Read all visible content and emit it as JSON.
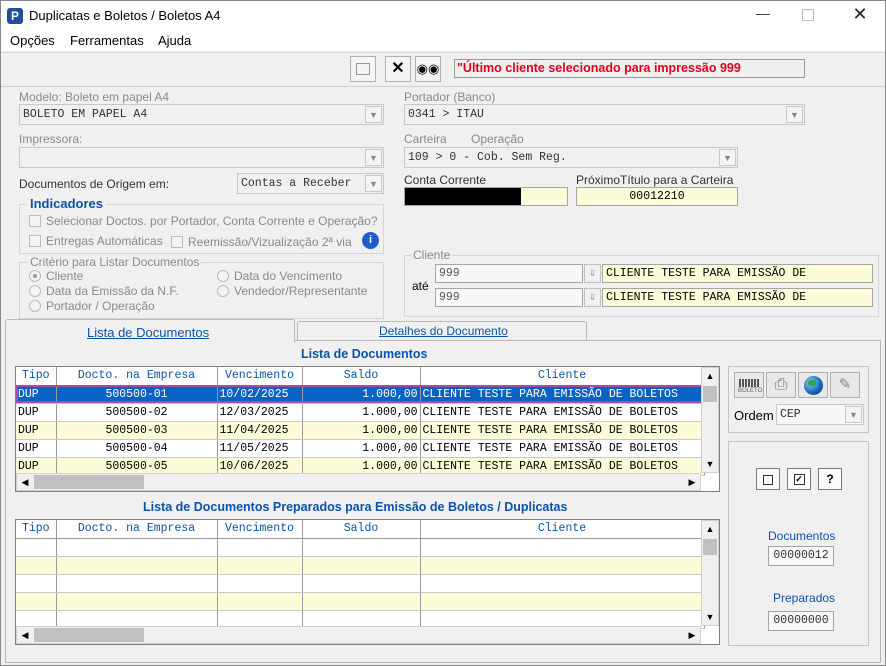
{
  "window": {
    "title": "Duplicatas e Boletos / Boletos A4"
  },
  "menu": [
    "Opções",
    "Ferramentas",
    "Ajuda"
  ],
  "toolbar": {
    "status_message": "\"Último cliente selecionado para impressão 999"
  },
  "form": {
    "modelo_label": "Modelo: Boleto em papel A4",
    "modelo_value": "BOLETO EM PAPEL A4",
    "portador_label": "Portador (Banco)",
    "portador_value": "0341 > ITAU",
    "impressora_label": "Impressora:",
    "impressora_value": "",
    "carteira_label": "Carteira",
    "operacao_label": "Operação",
    "carteira_value": "109   > 0 - Cob. Sem Reg.",
    "docs_origem_label": "Documentos de Origem em:",
    "docs_origem_value": "Contas a Receber",
    "conta_corrente_label": "Conta Corrente",
    "proximo_titulo_label": "PróximoTítulo para a Carteira",
    "proximo_titulo_value": "00012210"
  },
  "indicadores": {
    "title": "Indicadores",
    "opt1": "Selecionar Doctos. por Portador, Conta Corrente  e Operação?",
    "opt2": "Entregas Automáticas",
    "opt3": "Reemissão/Vizualização 2ª via"
  },
  "criterio": {
    "title": "Critério para Listar Documentos",
    "options": [
      "Cliente",
      "Data da Emissão da N.F.",
      "Portador / Operação",
      "Data do Vencimento",
      "Vendedor/Representante"
    ]
  },
  "cliente": {
    "title": "Cliente",
    "ate_label": "até",
    "from_code": "999",
    "from_name": "CLIENTE TESTE PARA EMISSÃO DE",
    "to_code": "999",
    "to_name": "CLIENTE TESTE PARA EMISSÃO DE"
  },
  "tabs": [
    "Lista de Documentos",
    "Detalhes do Documento"
  ],
  "lista": {
    "title": "Lista de Documentos",
    "columns": [
      "Tipo",
      "Docto. na Empresa",
      "Vencimento",
      "Saldo",
      "Cliente"
    ],
    "rows": [
      [
        "DUP",
        "500500-01",
        "10/02/2025",
        "1.000,00",
        "CLIENTE TESTE PARA EMISSÃO DE BOLETOS"
      ],
      [
        "DUP",
        "500500-02",
        "12/03/2025",
        "1.000,00",
        "CLIENTE TESTE PARA EMISSÃO DE BOLETOS"
      ],
      [
        "DUP",
        "500500-03",
        "11/04/2025",
        "1.000,00",
        "CLIENTE TESTE PARA EMISSÃO DE BOLETOS"
      ],
      [
        "DUP",
        "500500-04",
        "11/05/2025",
        "1.000,00",
        "CLIENTE TESTE PARA EMISSÃO DE BOLETOS"
      ],
      [
        "DUP",
        "500500-05",
        "10/06/2025",
        "1.000,00",
        "CLIENTE TESTE PARA EMISSÃO DE BOLETOS"
      ]
    ]
  },
  "preparados": {
    "title": "Lista de Documentos Preparados para Emissão de Boletos / Duplicatas",
    "columns": [
      "Tipo",
      "Docto. na Empresa",
      "Vencimento",
      "Saldo",
      "Cliente"
    ]
  },
  "side": {
    "ordem_label": "Ordem",
    "ordem_value": "CEP",
    "question_label": "?",
    "documentos_label": "Documentos",
    "documentos_value": "00000012",
    "preparados_label": "Preparados",
    "preparados_value": "00000000"
  },
  "colors": {
    "accent": "#0a63c4",
    "status_red": "#e0001a",
    "header_blue": "#0b53a8",
    "row_yellow": "#fcfcd8",
    "highlight_border": "#a64ca6"
  }
}
